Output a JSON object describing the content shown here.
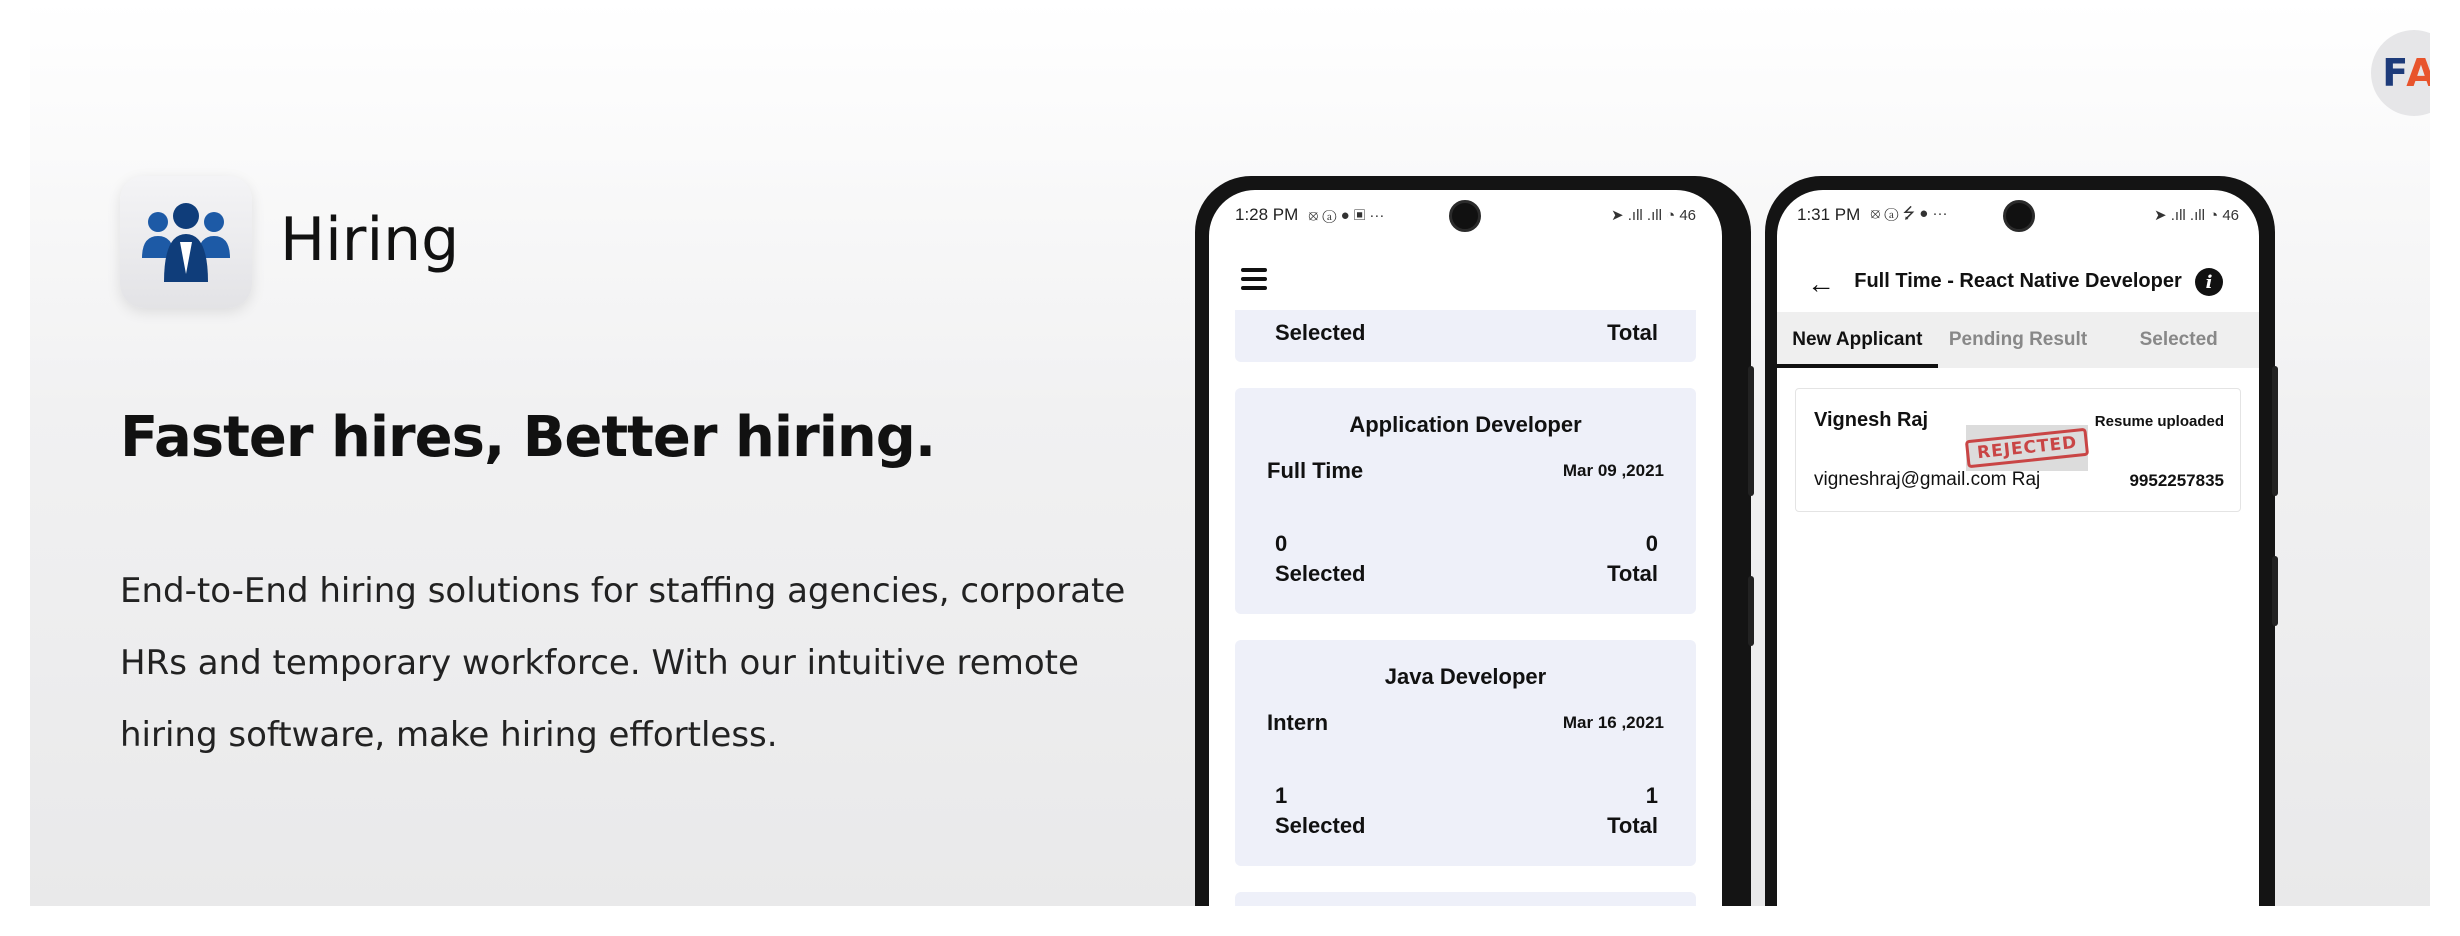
{
  "brand": {
    "logo_f": "F",
    "logo_ai": "AI"
  },
  "app": {
    "name": "Hiring"
  },
  "hero": {
    "headline": "Faster hires, Better hiring.",
    "description": "End-to-End hiring solutions for staffing agencies, corporate HRs and temporary workforce. With our intuitive remote hiring software, make hiring effortless."
  },
  "phone1": {
    "status_time": "1:28 PM",
    "status_icons": "⦻ ⓐ ● ▣ ···",
    "status_right": "➤ .ıll .ıll ◔ 46",
    "top_partial": {
      "selected_label": "Selected",
      "total_label": "Total"
    },
    "jobs": [
      {
        "title": "Application Developer",
        "type": "Full Time",
        "date": "Mar 09 ,2021",
        "selected": "0",
        "total": "0",
        "selected_label": "Selected",
        "total_label": "Total"
      },
      {
        "title": "Java Developer",
        "type": "Intern",
        "date": "Mar 16 ,2021",
        "selected": "1",
        "total": "1",
        "selected_label": "Selected",
        "total_label": "Total"
      }
    ]
  },
  "phone2": {
    "status_time": "1:31 PM",
    "status_icons": "⦻ ⓐ ⭍ ● ···",
    "status_right": "➤ .ıll .ıll ◔ 46",
    "title": "Full Time - React Native Developer",
    "tabs": [
      "New Applicant",
      "Pending Result",
      "Selected"
    ],
    "applicant": {
      "name": "Vignesh Raj",
      "status": "Resume uploaded",
      "email": "vigneshraj@gmail.com Raj",
      "phone": "9952257835",
      "stamp": "REJECTED"
    }
  },
  "colors": {
    "card_bg": "#eef0f9",
    "accent_blue": "#1d4f91",
    "logo_orange": "#e8542c",
    "stamp_red": "#c94545"
  }
}
